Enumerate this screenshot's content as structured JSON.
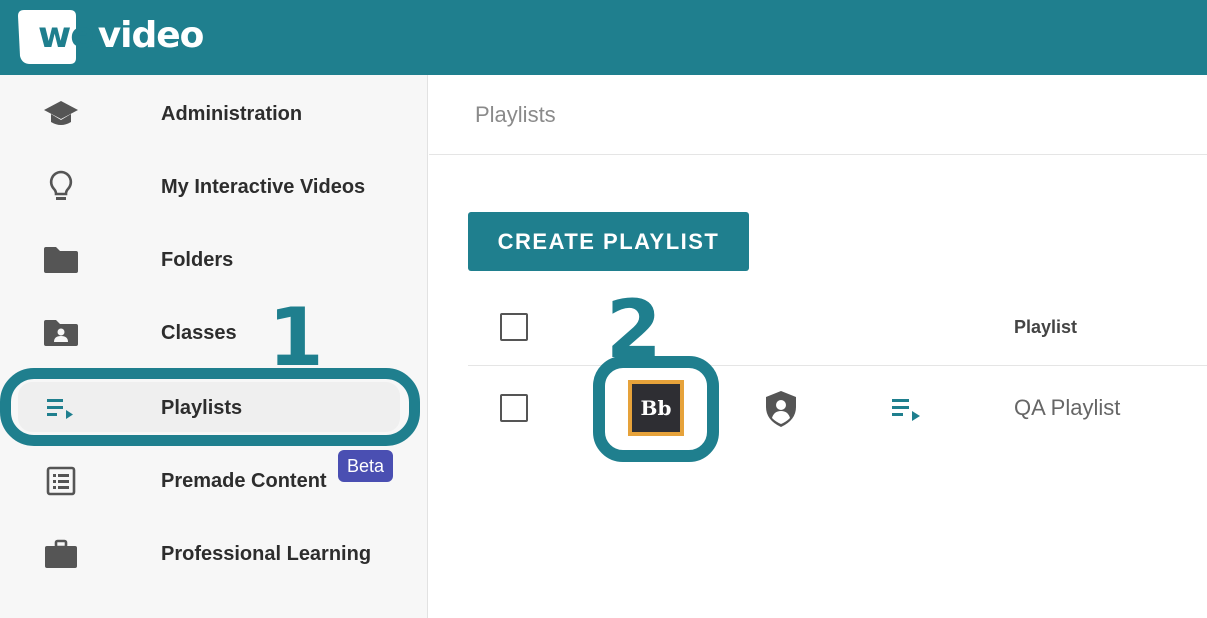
{
  "header": {
    "logo": {
      "part_we": "we",
      "part_video": "video"
    }
  },
  "colors": {
    "brand": "#1f7f8e",
    "badge": "#4a4fb2",
    "blackboard_border": "#e6a23a"
  },
  "sidebar": {
    "items": [
      {
        "label": "Administration",
        "icon": "graduation-cap-icon"
      },
      {
        "label": "My Interactive Videos",
        "icon": "lightbulb-icon"
      },
      {
        "label": "Folders",
        "icon": "folder-icon"
      },
      {
        "label": "Classes",
        "icon": "class-folder-icon"
      },
      {
        "label": "Playlists",
        "icon": "playlist-icon",
        "active": true
      },
      {
        "label": "Premade Content",
        "icon": "list-document-icon",
        "badge": "Beta"
      },
      {
        "label": "Professional Learning",
        "icon": "briefcase-icon"
      }
    ]
  },
  "annotations": {
    "step_1": "1",
    "step_2": "2"
  },
  "main": {
    "breadcrumb": "Playlists",
    "create_button": "CREATE PLAYLIST",
    "table": {
      "columns": {
        "playlist": "Playlist"
      },
      "rows": [
        {
          "integration_logo": "Bb",
          "title": "QA Playlist",
          "icons": [
            "blackboard-icon",
            "shield-user-icon",
            "playlist-icon"
          ]
        }
      ]
    }
  }
}
